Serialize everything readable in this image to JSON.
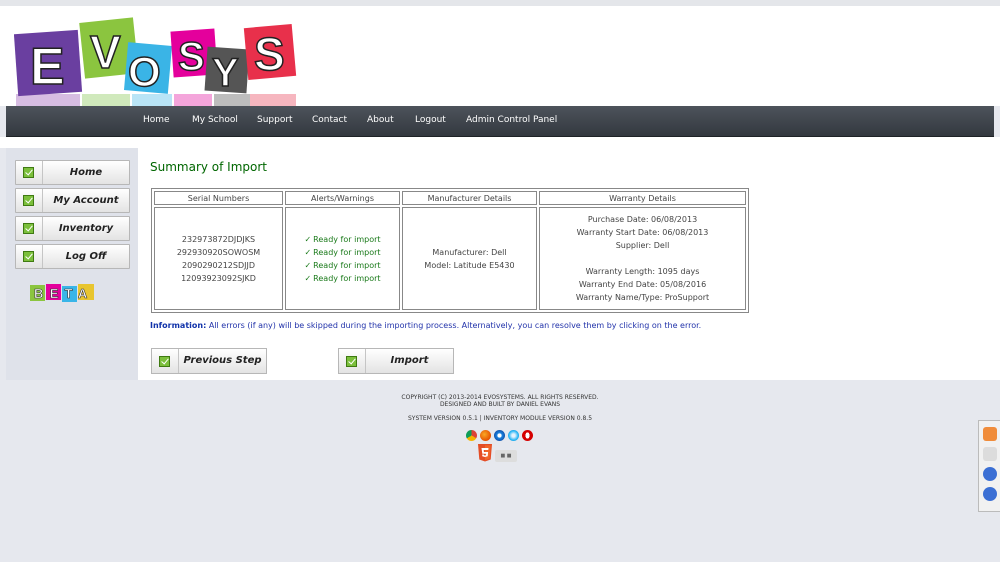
{
  "logo": {
    "text": "EVOSYS",
    "letters": [
      "E",
      "V",
      "O",
      "S",
      "Y",
      "S"
    ]
  },
  "nav": {
    "items": [
      "Home",
      "My School",
      "Support",
      "Contact",
      "About",
      "Logout",
      "Admin Control Panel"
    ]
  },
  "sidebar": {
    "items": [
      "Home",
      "My Account",
      "Inventory",
      "Log Off"
    ],
    "beta": "BETA"
  },
  "main": {
    "title": "Summary of Import",
    "table": {
      "headers": [
        "Serial Numbers",
        "Alerts/Warnings",
        "Manufacturer Details",
        "Warranty Details"
      ],
      "serials": [
        "232973872DJDJKS",
        "292930920SOWOSM",
        "2090290212SDJJD",
        "12093923092SJKD"
      ],
      "alerts": [
        "Ready for import",
        "Ready for import",
        "Ready for import",
        "Ready for import"
      ],
      "manufacturer": [
        "Manufacturer: Dell",
        "Model: Latitude E5430"
      ],
      "warranty": {
        "purchase": "Purchase Date: 06/08/2013",
        "start": "Warranty Start Date: 06/08/2013",
        "supplier": "Supplier: Dell",
        "length": "Warranty Length: 1095 days",
        "end": "Warranty End Date: 05/08/2016",
        "name": "Warranty Name/Type: ProSupport"
      }
    },
    "info_label": "Information:",
    "info_text": " All errors (if any) will be skipped during the importing process. Alternatively, you can resolve them by clicking on the error.",
    "prev_label": "Previous Step",
    "import_label": "Import"
  },
  "footer": {
    "copyright": "COPYRIGHT (C) 2013-2014 EVOSYSTEMS. ALL RIGHTS RESERVED.",
    "credit": "DESIGNED AND BUILT BY DANIEL EVANS",
    "version": "SYSTEM VERSION 0.5.1 | INVENTORY MODULE VERSION 0.8.5",
    "browser_icons": [
      "chrome-icon",
      "firefox-icon",
      "ie-icon",
      "safari-icon",
      "opera-icon"
    ],
    "html5_icon": "html5-icon",
    "css3_icon": "css3-icon"
  },
  "colors": {
    "title_green": "#006600",
    "info_blue": "#2233aa",
    "nav_bg": "#3d4249",
    "check_green": "#7bbf3b"
  }
}
